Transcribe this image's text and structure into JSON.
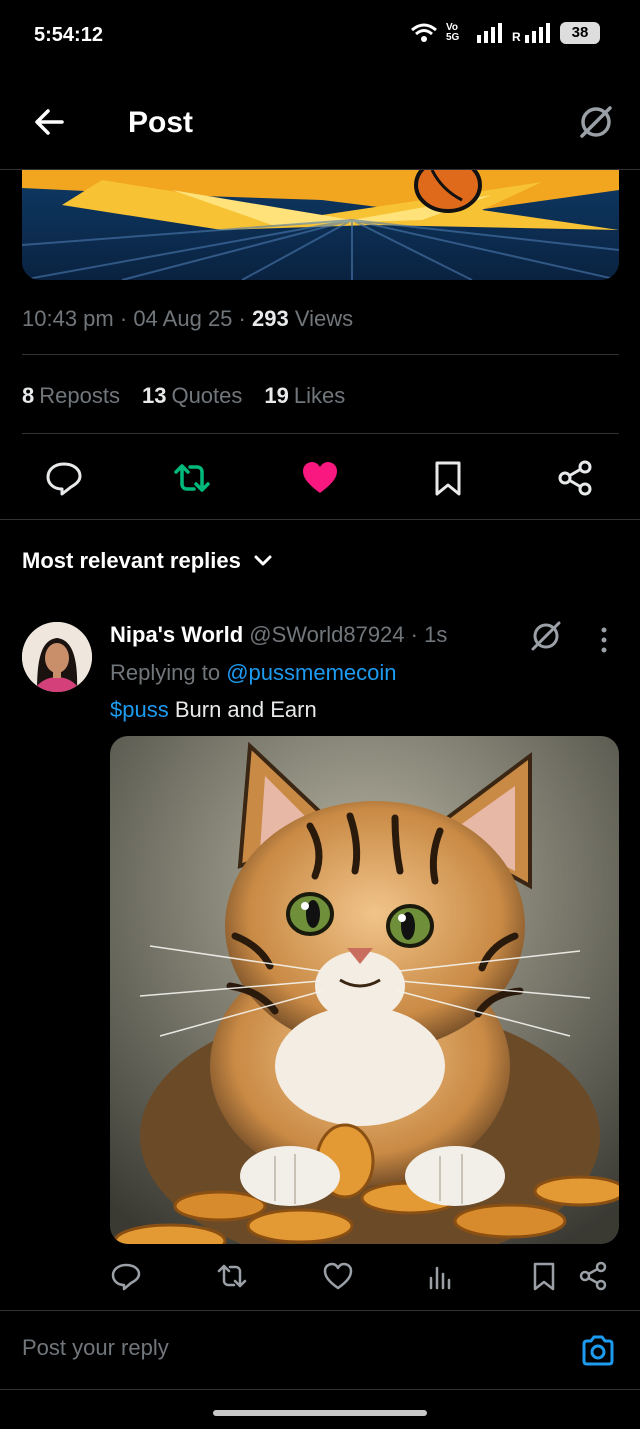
{
  "status_bar": {
    "time": "5:54:12",
    "battery": "38",
    "network_label": "Vo 5G"
  },
  "header": {
    "title": "Post",
    "back_icon": "arrow-left-icon",
    "grok_icon": "grok-icon"
  },
  "post": {
    "time": "10:43 pm",
    "date": "04 Aug 25",
    "views_count": "293",
    "views_label": "Views",
    "separator": "·",
    "stats": [
      {
        "count": "8",
        "label": "Reposts"
      },
      {
        "count": "13",
        "label": "Quotes"
      },
      {
        "count": "19",
        "label": "Likes"
      }
    ],
    "liked": true,
    "reposted": true
  },
  "sort": {
    "label": "Most relevant replies"
  },
  "reply": {
    "name": "Nipa's World",
    "handle": "@SWorld87924",
    "time": "· 1s",
    "replying_prefix": "Replying to",
    "replying_handle": "@pussmemecoin",
    "cashtag": "$puss",
    "text": "Burn and Earn"
  },
  "compose": {
    "placeholder": "Post your reply"
  },
  "colors": {
    "like": "#f91880",
    "repost": "#00ba7c",
    "link": "#1d9bf0",
    "muted": "#71767b"
  }
}
